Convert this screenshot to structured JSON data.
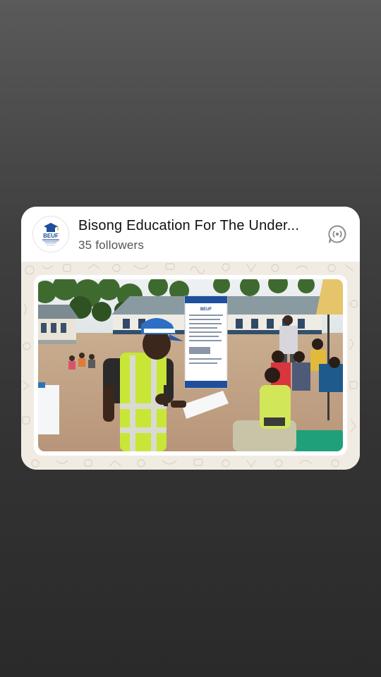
{
  "channel": {
    "name": "Bisong Education For The Under...",
    "followers": "35 followers",
    "avatar": {
      "logo_text": "BEUF",
      "icon": "graduation-cap-icon"
    },
    "action_icon": "channel-broadcast-icon"
  },
  "post": {
    "image": "photo-community-meeting",
    "banner": {
      "logo_text": "BEUF"
    }
  },
  "colors": {
    "background_top": "#5a5a5a",
    "background_bottom": "#2a2a2a",
    "card": "#ffffff",
    "chat_wallpaper": "#f1ece3",
    "brand_blue": "#1f4e9c"
  }
}
